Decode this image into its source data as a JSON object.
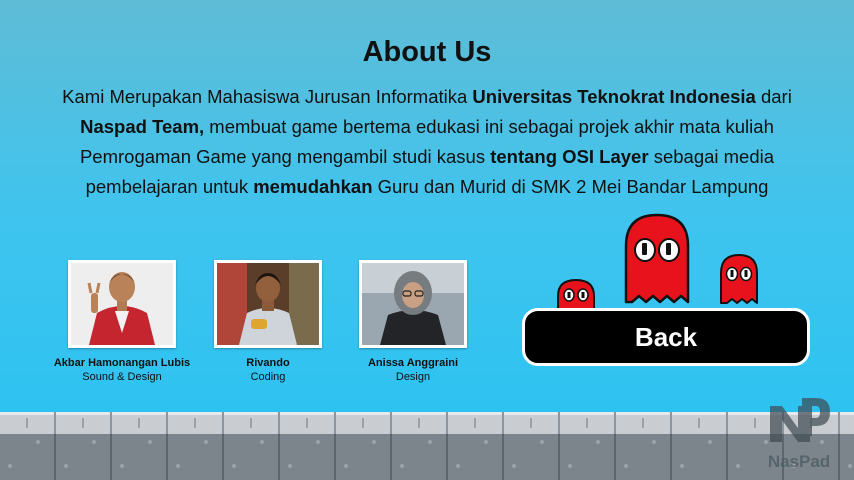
{
  "title": "About Us",
  "paragraph": {
    "p1": "Kami Merupakan Mahasiswa Jurusan Informatika ",
    "b1": "Universitas Teknokrat Indonesia",
    "p2": " dari ",
    "b2": "Naspad Team,",
    "p3": " membuat game bertema edukasi ini sebagai projek akhir mata kuliah Pemrogaman Game yang mengambil studi kasus ",
    "b3": "tentang OSI Layer",
    "p4": " sebagai media pembelajaran untuk ",
    "b4": "memudahkan",
    "p5": " Guru dan Murid di SMK 2 Mei Bandar Lampung"
  },
  "members": [
    {
      "name": "Akbar Hamonangan Lubis",
      "role": "Sound & Design"
    },
    {
      "name": "Rivando",
      "role": "Coding"
    },
    {
      "name": "Anissa Anggraini",
      "role": "Design"
    }
  ],
  "back_label": "Back",
  "logo_text": "NasPad",
  "colors": {
    "ghost": "#e8121c",
    "button": "#000000",
    "sky": "#28c2f2"
  }
}
